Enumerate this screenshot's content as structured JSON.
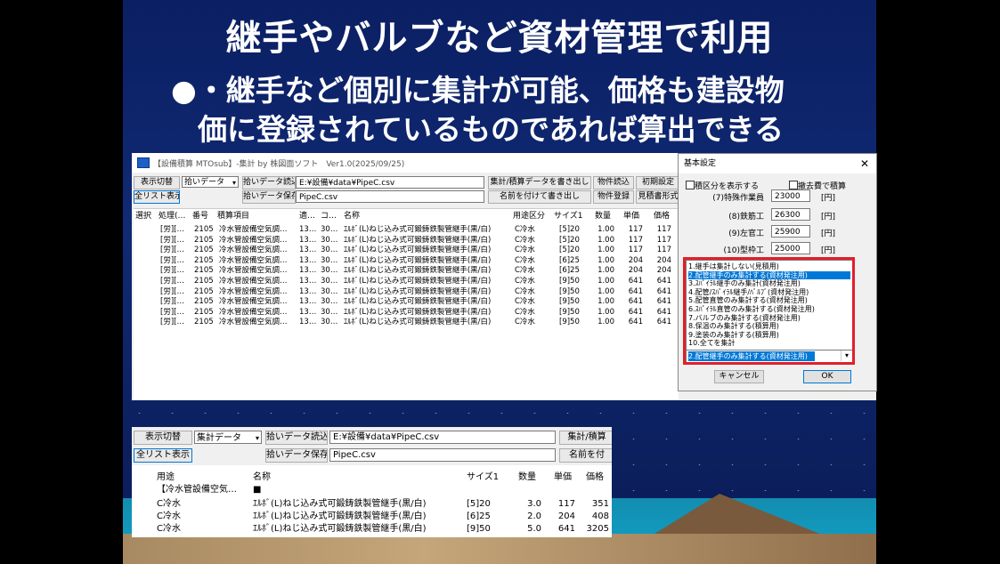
{
  "slide": {
    "title": "継手やバルブなど資材管理で利用",
    "bullet_line1": "●・継手など個別に集計が可能、価格も建設物",
    "bullet_line2": "価に登録されているものであれば算出できる"
  },
  "main_window": {
    "title": "【設備積算 MTOsub】-集計 by 株図面ソフト　Ver1.0(2025/09/25)",
    "btn_toggle": "表示切替",
    "select_value": "拾いデータ",
    "btn_load": "拾いデータ読込",
    "btn_save": "拾いデータ保存",
    "btn_all_list": "全リスト表示",
    "path_value": "E:¥設備¥data¥PipeC.csv",
    "file_value": "PipeC.csv",
    "btn_export": "集計/積算データを書き出し",
    "btn_saveas": "名前を付けて書き出し",
    "btn_item_load": "物件読込",
    "btn_item_register": "物件登録",
    "btn_init": "初期設定",
    "btn_format": "見積書形式",
    "columns": [
      "選択",
      "処理(…",
      "番号",
      "積算項目",
      "適…",
      "コ…",
      "名称",
      "用途区分",
      "サイズ1",
      "数量",
      "単価",
      "価格"
    ],
    "rows": [
      [
        "[労][…",
        "2105",
        "冷水管設備空気調…",
        "13…",
        "30…",
        "ｴﾙﾎﾞ(L)ねじ込み式可鍛鋳鉄製管継手(黒/白)",
        "C冷水",
        "[5]20",
        "1.00",
        "117",
        "117"
      ],
      [
        "[労][…",
        "2105",
        "冷水管設備空気調…",
        "13…",
        "30…",
        "ｴﾙﾎﾞ(L)ねじ込み式可鍛鋳鉄製管継手(黒/白)",
        "C冷水",
        "[5]20",
        "1.00",
        "117",
        "117"
      ],
      [
        "[労][…",
        "2105",
        "冷水管設備空気調…",
        "13…",
        "30…",
        "ｴﾙﾎﾞ(L)ねじ込み式可鍛鋳鉄製管継手(黒/白)",
        "C冷水",
        "[5]20",
        "1.00",
        "117",
        "117"
      ],
      [
        "[労][…",
        "2105",
        "冷水管設備空気調…",
        "13…",
        "30…",
        "ｴﾙﾎﾞ(L)ねじ込み式可鍛鋳鉄製管継手(黒/白)",
        "C冷水",
        "[6]25",
        "1.00",
        "204",
        "204"
      ],
      [
        "[労][…",
        "2105",
        "冷水管設備空気調…",
        "13…",
        "30…",
        "ｴﾙﾎﾞ(L)ねじ込み式可鍛鋳鉄製管継手(黒/白)",
        "C冷水",
        "[6]25",
        "1.00",
        "204",
        "204"
      ],
      [
        "[労][…",
        "2105",
        "冷水管設備空気調…",
        "13…",
        "30…",
        "ｴﾙﾎﾞ(L)ねじ込み式可鍛鋳鉄製管継手(黒/白)",
        "C冷水",
        "[9]50",
        "1.00",
        "641",
        "641"
      ],
      [
        "[労][…",
        "2105",
        "冷水管設備空気調…",
        "13…",
        "30…",
        "ｴﾙﾎﾞ(L)ねじ込み式可鍛鋳鉄製管継手(黒/白)",
        "C冷水",
        "[9]50",
        "1.00",
        "641",
        "641"
      ],
      [
        "[労][…",
        "2105",
        "冷水管設備空気調…",
        "13…",
        "30…",
        "ｴﾙﾎﾞ(L)ねじ込み式可鍛鋳鉄製管継手(黒/白)",
        "C冷水",
        "[9]50",
        "1.00",
        "641",
        "641"
      ],
      [
        "[労][…",
        "2105",
        "冷水管設備空気調…",
        "13…",
        "30…",
        "ｴﾙﾎﾞ(L)ねじ込み式可鍛鋳鉄製管継手(黒/白)",
        "C冷水",
        "[9]50",
        "1.00",
        "641",
        "641"
      ],
      [
        "[労][…",
        "2105",
        "冷水管設備空気調…",
        "13…",
        "30…",
        "ｴﾙﾎﾞ(L)ねじ込み式可鍛鋳鉄製管継手(黒/白)",
        "C冷水",
        "[9]50",
        "1.00",
        "641",
        "641"
      ]
    ]
  },
  "dialog": {
    "title": "基本設定",
    "close": "✕",
    "cb1_label": "積区分を表示する",
    "cb2_label": "撤去費で積算",
    "wages": [
      {
        "label": "(7)特殊作業員",
        "value": "23000",
        "unit": "[円]"
      },
      {
        "label": "(8)鉄筋工",
        "value": "26300",
        "unit": "[円]"
      },
      {
        "label": "(9)左官工",
        "value": "25900",
        "unit": "[円]"
      },
      {
        "label": "(10)型枠工",
        "value": "25000",
        "unit": "[円]"
      }
    ],
    "list_items": [
      "1.継手は集計しない(見積用)",
      "2.配管継手のみ集計する(資材発注用)",
      "3.ｽﾊﾟｲﾗﾙ継手のみ集計(資材発注用)",
      "4.配管/ｽﾊﾟｲﾗﾙ継手/ﾊﾞﾙﾌﾞ(資材発注用)",
      "5.配管直管のみ集計する(資材発注用)",
      "6.ｽﾊﾟｲﾗﾙ直管のみ集計する(資材発注用)",
      "7.バルブのみ集計する(資材発注用)",
      "8.保温のみ集計する(積算用)",
      "9.塗装のみ集計する(積算用)",
      "10.全てを集計"
    ],
    "combo_value": "2.配管継手のみ集計する(資材発注用)",
    "btn_cancel": "キャンセル",
    "btn_ok": "OK"
  },
  "summary_window": {
    "btn_toggle": "表示切替",
    "select_value": "集計データ",
    "btn_load": "拾いデータ読込",
    "btn_save": "拾いデータ保存",
    "btn_all_list": "全リスト表示",
    "path_value": "E:¥設備¥data¥PipeC.csv",
    "file_value": "PipeC.csv",
    "btn_export": "集計/積算",
    "btn_saveas": "名前を付",
    "columns": [
      "用途",
      "名称",
      "サイズ1",
      "数量",
      "単価",
      "価格"
    ],
    "group_label": "【冷水管設備空気…",
    "group_mark": "■",
    "rows": [
      [
        "C冷水",
        "ｴﾙﾎﾞ(L)ねじ込み式可鍛鋳鉄製管継手(黒/白)",
        "[5]20",
        "3.0",
        "117",
        "351"
      ],
      [
        "C冷水",
        "ｴﾙﾎﾞ(L)ねじ込み式可鍛鋳鉄製管継手(黒/白)",
        "[6]25",
        "2.0",
        "204",
        "408"
      ],
      [
        "C冷水",
        "ｴﾙﾎﾞ(L)ねじ込み式可鍛鋳鉄製管継手(黒/白)",
        "[9]50",
        "5.0",
        "641",
        "3205"
      ]
    ]
  }
}
